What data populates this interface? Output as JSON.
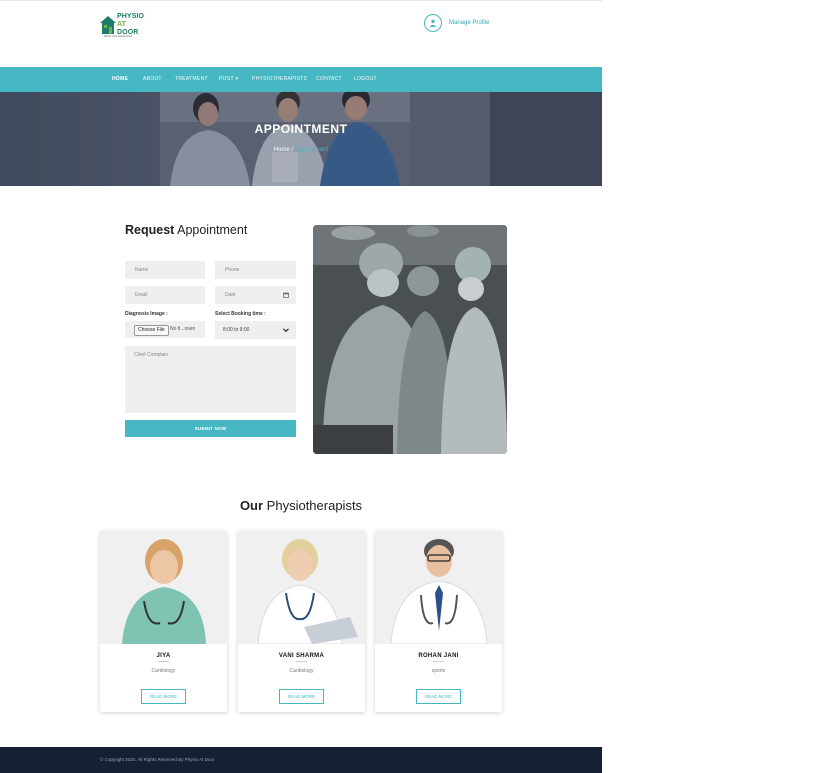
{
  "brand": {
    "logo_lines": [
      "PHYSIO",
      "AT",
      "DOOR"
    ],
    "tagline": "Where Your Comfort First",
    "colors": {
      "accent": "#46b8c4",
      "logo_green": "#6bb544",
      "logo_teal": "#1e7d6a",
      "footer": "#152133"
    }
  },
  "header": {
    "profile_label": "Manage Profile",
    "profile_icon": "user-icon"
  },
  "nav": {
    "items": [
      "HOME",
      "ABOUT",
      "TREATMENT",
      "POST",
      "PHYSIOTHERAPISTS",
      "CONTACT",
      "LOGOUT"
    ],
    "active": "HOME",
    "dropdown_mark": "▾"
  },
  "banner": {
    "title": "APPOINTMENT",
    "crumb_home": "Home",
    "crumb_sep": "/",
    "crumb_current": "Appointment"
  },
  "form": {
    "title_bold": "Request",
    "title_rest": " Appointment",
    "name_placeholder": "Name",
    "phone_placeholder": "Phone",
    "email_placeholder": "Email",
    "date_placeholder": "Date",
    "diag_label": "Diagnosis Image :",
    "file_button": "Choose File",
    "file_name": "No fi...osen",
    "time_label": "Select Booking time :",
    "time_value": "8:00 to 9:00",
    "complain_placeholder": "Chief Complain",
    "submit": "SUBMIT NOW"
  },
  "team": {
    "title_bold": "Our",
    "title_rest": " Physiotherapists",
    "members": [
      {
        "name": "JIYA",
        "specialty": "Cardiology",
        "button": "READ MORE"
      },
      {
        "name": "VANI SHARMA",
        "specialty": "Cardiology",
        "button": "READ MORE"
      },
      {
        "name": "ROHAN JANI",
        "specialty": "sports",
        "button": "READ MORE"
      }
    ]
  },
  "footer": {
    "copyright": "© Copyright 2020. All Rights Reserved By Physio At Door"
  }
}
